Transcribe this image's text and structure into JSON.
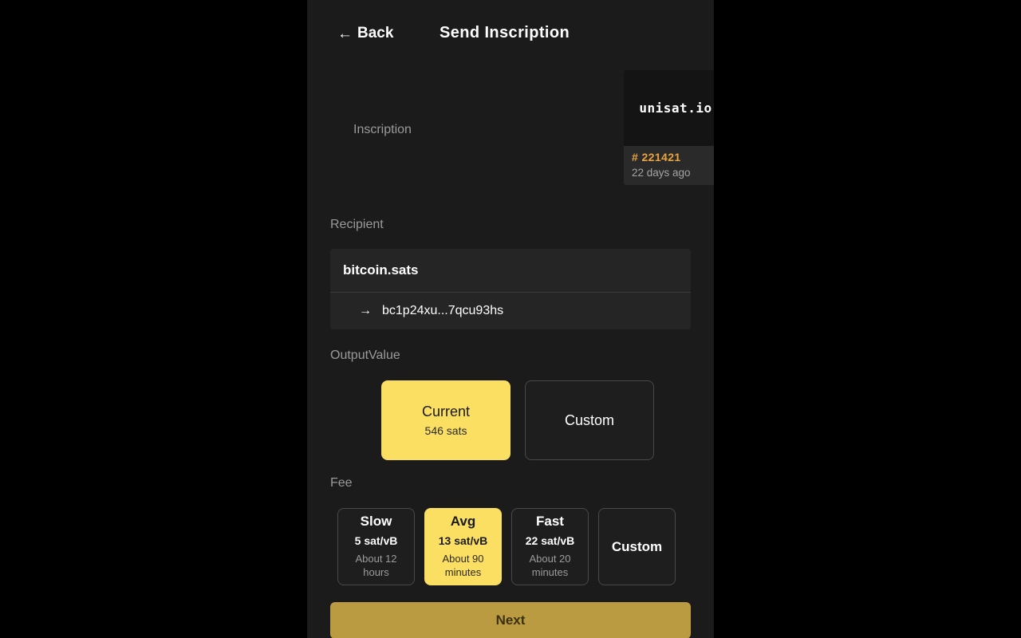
{
  "header": {
    "back_label": "Back",
    "back_icon": "arrow-left-icon",
    "title": "Send Inscription"
  },
  "inscription": {
    "label": "Inscription",
    "preview_text": "unisat.io",
    "number": "# 221421",
    "age": "22 days ago"
  },
  "recipient": {
    "label": "Recipient",
    "name": "bitcoin.sats",
    "arrow_icon": "arrow-right-icon",
    "address": "bc1p24xu...7qcu93hs"
  },
  "output_value": {
    "label": "OutputValue",
    "options": [
      {
        "title": "Current",
        "subtitle": "546 sats",
        "selected": true
      },
      {
        "title": "Custom",
        "subtitle": "",
        "selected": false
      }
    ]
  },
  "fee": {
    "label": "Fee",
    "options": [
      {
        "name": "Slow",
        "rate": "5 sat/vB",
        "time": "About 12 hours",
        "selected": false
      },
      {
        "name": "Avg",
        "rate": "13 sat/vB",
        "time": "About 90 minutes",
        "selected": true
      },
      {
        "name": "Fast",
        "rate": "22 sat/vB",
        "time": "About 20 minutes",
        "selected": false
      },
      {
        "name": "Custom",
        "rate": "",
        "time": "",
        "selected": false
      }
    ]
  },
  "submit": {
    "label": "Next"
  },
  "colors": {
    "accent": "#fadf62",
    "accent_dim": "#bb9b41",
    "inscription_number": "#e9a33c",
    "background": "#1c1b1b",
    "card": "#262525"
  }
}
